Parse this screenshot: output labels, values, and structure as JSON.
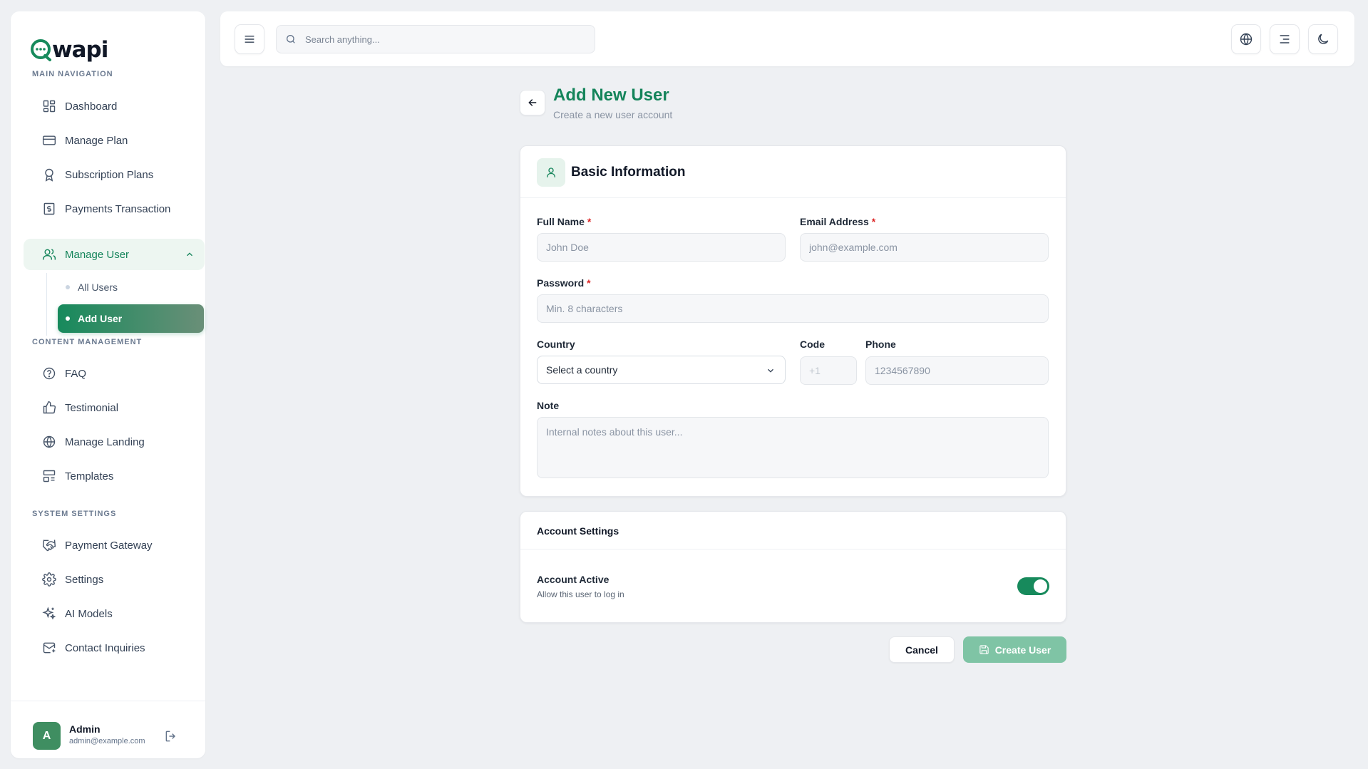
{
  "brand": {
    "name": "wapi",
    "accent": "#14845a"
  },
  "sidebar": {
    "sections": {
      "main": "MAIN NAVIGATION",
      "content": "CONTENT MANAGEMENT",
      "system": "SYSTEM SETTINGS"
    },
    "items": {
      "dashboard": {
        "label": "Dashboard",
        "icon": "dashboard-icon"
      },
      "manage_plan": {
        "label": "Manage Plan",
        "icon": "credit-card-icon"
      },
      "subscription_plans": {
        "label": "Subscription Plans",
        "icon": "award-icon"
      },
      "payments_transaction": {
        "label": "Payments Transaction",
        "icon": "receipt-icon"
      },
      "manage_user": {
        "label": "Manage User",
        "icon": "users-icon",
        "expanded": true
      },
      "faq": {
        "label": "FAQ",
        "icon": "help-circle-icon"
      },
      "testimonial": {
        "label": "Testimonial",
        "icon": "thumbs-up-icon"
      },
      "manage_landing": {
        "label": "Manage Landing",
        "icon": "globe-icon"
      },
      "templates": {
        "label": "Templates",
        "icon": "layout-icon"
      },
      "payment_gateway": {
        "label": "Payment Gateway",
        "icon": "handshake-icon"
      },
      "settings": {
        "label": "Settings",
        "icon": "gear-icon"
      },
      "ai_models": {
        "label": "AI Models",
        "icon": "sparkles-icon"
      },
      "contact_inquiries": {
        "label": "Contact Inquiries",
        "icon": "mail-icon"
      }
    },
    "subitems": {
      "all_users": "All Users",
      "add_user": "Add User"
    },
    "user": {
      "initial": "A",
      "name": "Admin",
      "email": "admin@example.com"
    }
  },
  "topbar": {
    "search_placeholder": "Search anything..."
  },
  "page": {
    "title": "Add New User",
    "subtitle": "Create a new user account"
  },
  "basic_info": {
    "title": "Basic Information",
    "full_name": {
      "label": "Full Name",
      "placeholder": "John Doe"
    },
    "email": {
      "label": "Email Address",
      "placeholder": "john@example.com"
    },
    "password": {
      "label": "Password",
      "placeholder": "Min. 8 characters"
    },
    "country": {
      "label": "Country",
      "value": "Select a country"
    },
    "code": {
      "label": "Code",
      "placeholder": "+1"
    },
    "phone": {
      "label": "Phone",
      "placeholder": "1234567890"
    },
    "note": {
      "label": "Note",
      "placeholder": "Internal notes about this user..."
    },
    "required_mark": "*"
  },
  "account_settings": {
    "title": "Account Settings",
    "active_label": "Account Active",
    "active_desc": "Allow this user to log in",
    "active": true
  },
  "actions": {
    "cancel": "Cancel",
    "create": "Create User"
  }
}
